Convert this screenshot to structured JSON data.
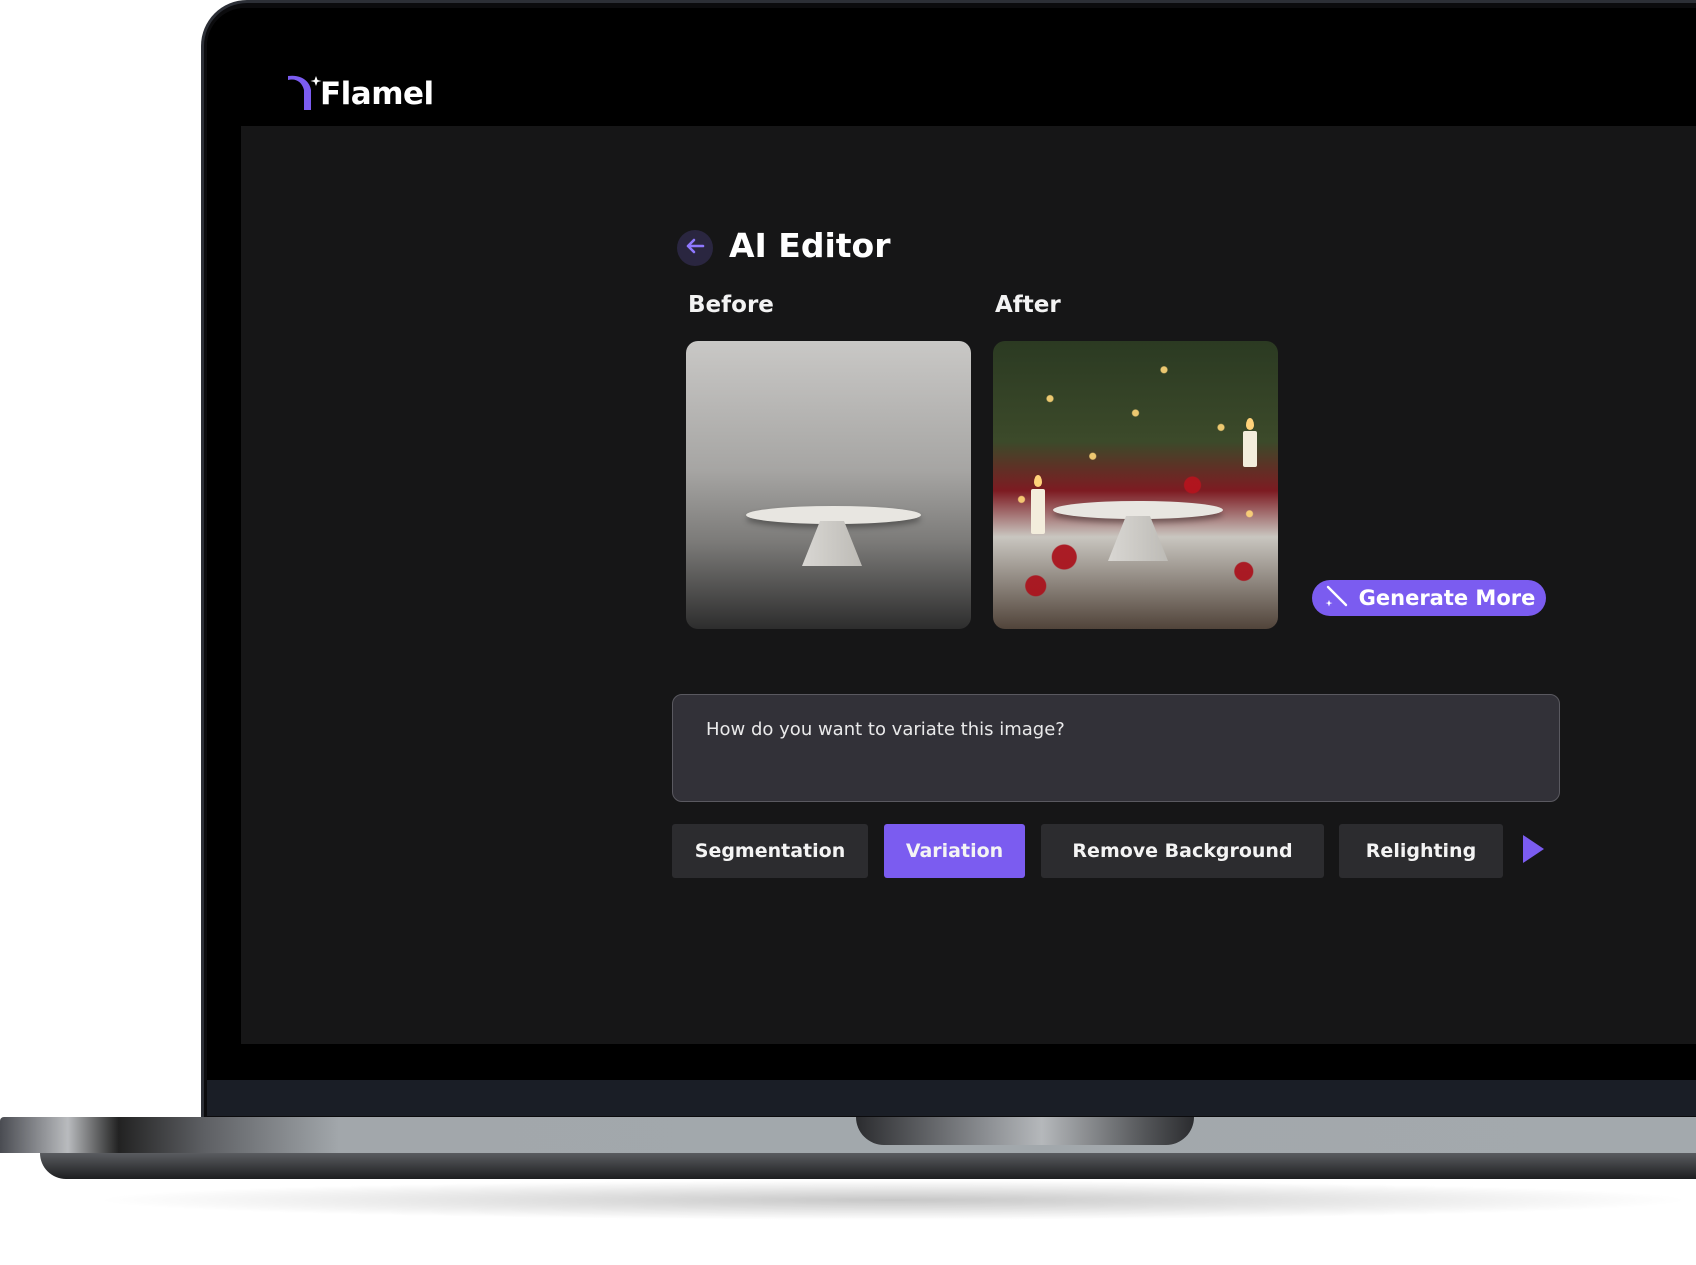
{
  "brand": {
    "name": "Flamel"
  },
  "editor": {
    "title": "AI Editor",
    "before_label": "Before",
    "after_label": "After",
    "generate_more_label": "Generate More",
    "prompt_placeholder": "How do you want to variate this image?",
    "tools": [
      {
        "label": "Segmentation",
        "active": false
      },
      {
        "label": "Variation",
        "active": true
      },
      {
        "label": "Remove Background",
        "active": false
      },
      {
        "label": "Relighting",
        "active": false
      }
    ]
  },
  "colors": {
    "accent": "#7b5cf0",
    "background": "#161617",
    "button_bg": "#2c2c2f",
    "prompt_bg": "#323138"
  },
  "icons": [
    "arrow-left-icon",
    "magic-wand-icon",
    "play-right-icon",
    "flamel-logo-icon"
  ]
}
